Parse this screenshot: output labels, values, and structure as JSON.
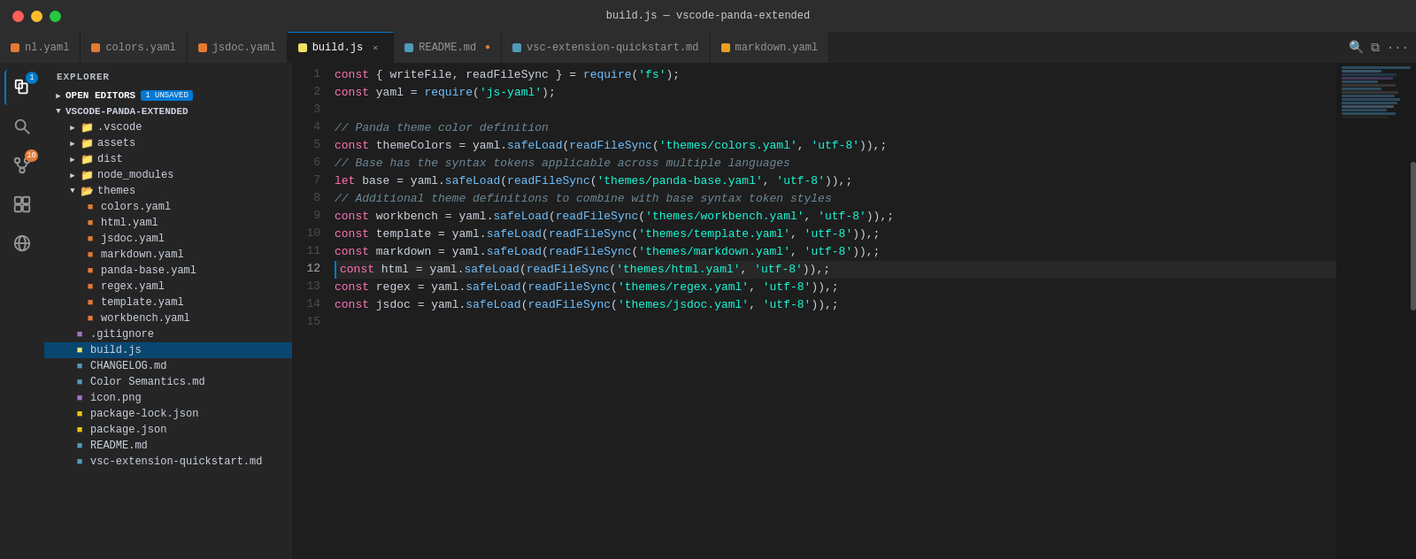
{
  "titleBar": {
    "title": "build.js — vscode-panda-extended"
  },
  "tabs": [
    {
      "id": "nl-yaml",
      "label": "nl.yaml",
      "icon": "yaml",
      "active": false,
      "modified": false,
      "color": "#e37933"
    },
    {
      "id": "colors-yaml",
      "label": "colors.yaml",
      "icon": "yaml",
      "active": false,
      "modified": false,
      "color": "#e37933"
    },
    {
      "id": "jsdoc-yaml",
      "label": "jsdoc.yaml",
      "icon": "yaml",
      "active": false,
      "modified": false,
      "color": "#e37933"
    },
    {
      "id": "build-js",
      "label": "build.js",
      "icon": "js",
      "active": true,
      "modified": false,
      "color": "#f0e164"
    },
    {
      "id": "readme-md",
      "label": "README.md",
      "icon": "md",
      "active": false,
      "modified": true,
      "color": "#519aba"
    },
    {
      "id": "vsc-quickstart",
      "label": "vsc-extension-quickstart.md",
      "icon": "md",
      "active": false,
      "modified": false,
      "color": "#519aba"
    },
    {
      "id": "markdown-yaml",
      "label": "markdown.yaml",
      "icon": "yaml",
      "active": false,
      "modified": false,
      "color": "#e8a020"
    }
  ],
  "sidebar": {
    "openEditors": {
      "label": "OPEN EDITORS",
      "badge": "1 UNSAVED"
    },
    "projectName": "VSCODE-PANDA-EXTENDED",
    "tree": [
      {
        "id": "vscode",
        "label": ".vscode",
        "type": "folder",
        "indent": 1,
        "expanded": false
      },
      {
        "id": "assets",
        "label": "assets",
        "type": "folder",
        "indent": 1,
        "expanded": false
      },
      {
        "id": "dist",
        "label": "dist",
        "type": "folder",
        "indent": 1,
        "expanded": false
      },
      {
        "id": "node_modules",
        "label": "node_modules",
        "type": "folder",
        "indent": 1,
        "expanded": false
      },
      {
        "id": "themes",
        "label": "themes",
        "type": "folder",
        "indent": 1,
        "expanded": true
      },
      {
        "id": "colors-yaml",
        "label": "colors.yaml",
        "type": "yaml",
        "indent": 2
      },
      {
        "id": "html-yaml",
        "label": "html.yaml",
        "type": "yaml",
        "indent": 2
      },
      {
        "id": "jsdoc-yaml",
        "label": "jsdoc.yaml",
        "type": "yaml",
        "indent": 2
      },
      {
        "id": "markdown-yaml",
        "label": "markdown.yaml",
        "type": "yaml",
        "indent": 2
      },
      {
        "id": "panda-base-yaml",
        "label": "panda-base.yaml",
        "type": "yaml",
        "indent": 2
      },
      {
        "id": "regex-yaml",
        "label": "regex.yaml",
        "type": "yaml",
        "indent": 2
      },
      {
        "id": "template-yaml",
        "label": "template.yaml",
        "type": "yaml",
        "indent": 2
      },
      {
        "id": "workbench-yaml",
        "label": "workbench.yaml",
        "type": "yaml",
        "indent": 2
      },
      {
        "id": "gitignore",
        "label": ".gitignore",
        "type": "gitignore",
        "indent": 1
      },
      {
        "id": "build-js",
        "label": "build.js",
        "type": "js",
        "indent": 1
      },
      {
        "id": "changelog-md",
        "label": "CHANGELOG.md",
        "type": "md",
        "indent": 1
      },
      {
        "id": "color-semantics-md",
        "label": "Color Semantics.md",
        "type": "md",
        "indent": 1
      },
      {
        "id": "icon-png",
        "label": "icon.png",
        "type": "png",
        "indent": 1
      },
      {
        "id": "package-lock-json",
        "label": "package-lock.json",
        "type": "json",
        "indent": 1
      },
      {
        "id": "package-json",
        "label": "package.json",
        "type": "json",
        "indent": 1
      },
      {
        "id": "readme-md",
        "label": "README.md",
        "type": "md",
        "indent": 1
      },
      {
        "id": "vsc-quickstart-md",
        "label": "vsc-extension-quickstart.md",
        "type": "md",
        "indent": 1
      }
    ]
  },
  "editor": {
    "filename": "build.js",
    "lines": [
      {
        "num": 1,
        "tokens": [
          {
            "t": "kw",
            "v": "const"
          },
          {
            "t": "plain",
            "v": " { writeFile, readFileSync } "
          },
          {
            "t": "op",
            "v": "="
          },
          {
            "t": "plain",
            "v": " "
          },
          {
            "t": "fn",
            "v": "require"
          },
          {
            "t": "punc",
            "v": "("
          },
          {
            "t": "str",
            "v": "'fs'"
          },
          {
            "t": "punc",
            "v": ")"
          },
          {
            "t": "plain",
            "v": ";"
          }
        ]
      },
      {
        "num": 2,
        "tokens": [
          {
            "t": "kw",
            "v": "const"
          },
          {
            "t": "plain",
            "v": " yaml "
          },
          {
            "t": "op",
            "v": "="
          },
          {
            "t": "plain",
            "v": " "
          },
          {
            "t": "fn",
            "v": "require"
          },
          {
            "t": "punc",
            "v": "("
          },
          {
            "t": "str",
            "v": "'js-yaml'"
          },
          {
            "t": "punc",
            "v": ")"
          },
          {
            "t": "plain",
            "v": ";"
          }
        ]
      },
      {
        "num": 3,
        "tokens": []
      },
      {
        "num": 4,
        "tokens": [
          {
            "t": "cm",
            "v": "// Panda theme color definition"
          }
        ]
      },
      {
        "num": 5,
        "tokens": [
          {
            "t": "kw",
            "v": "const"
          },
          {
            "t": "plain",
            "v": " themeColors "
          },
          {
            "t": "op",
            "v": "="
          },
          {
            "t": "plain",
            "v": " yaml."
          },
          {
            "t": "fn",
            "v": "safeLoad"
          },
          {
            "t": "punc",
            "v": "("
          },
          {
            "t": "fn",
            "v": "readFileSync"
          },
          {
            "t": "punc",
            "v": "("
          },
          {
            "t": "str",
            "v": "'themes/colors.yaml'"
          },
          {
            "t": "plain",
            "v": ", "
          },
          {
            "t": "str",
            "v": "'utf-8'"
          },
          {
            "t": "punc",
            "v": ")),"
          },
          {
            "t": "plain",
            "v": ";"
          }
        ]
      },
      {
        "num": 6,
        "tokens": [
          {
            "t": "cm",
            "v": "// Base has the syntax tokens applicable across multiple languages"
          }
        ]
      },
      {
        "num": 7,
        "tokens": [
          {
            "t": "kw",
            "v": "let"
          },
          {
            "t": "plain",
            "v": " base "
          },
          {
            "t": "op",
            "v": "="
          },
          {
            "t": "plain",
            "v": " yaml."
          },
          {
            "t": "fn",
            "v": "safeLoad"
          },
          {
            "t": "punc",
            "v": "("
          },
          {
            "t": "fn",
            "v": "readFileSync"
          },
          {
            "t": "punc",
            "v": "("
          },
          {
            "t": "str",
            "v": "'themes/panda-base.yaml'"
          },
          {
            "t": "plain",
            "v": ", "
          },
          {
            "t": "str",
            "v": "'utf-8'"
          },
          {
            "t": "punc",
            "v": ")),"
          },
          {
            "t": "plain",
            "v": ";"
          }
        ]
      },
      {
        "num": 8,
        "tokens": [
          {
            "t": "cm",
            "v": "// Additional theme definitions to combine with base syntax token styles"
          }
        ]
      },
      {
        "num": 9,
        "tokens": [
          {
            "t": "kw",
            "v": "const"
          },
          {
            "t": "plain",
            "v": " workbench "
          },
          {
            "t": "op",
            "v": "="
          },
          {
            "t": "plain",
            "v": " yaml."
          },
          {
            "t": "fn",
            "v": "safeLoad"
          },
          {
            "t": "punc",
            "v": "("
          },
          {
            "t": "fn",
            "v": "readFileSync"
          },
          {
            "t": "punc",
            "v": "("
          },
          {
            "t": "str",
            "v": "'themes/workbench.yaml'"
          },
          {
            "t": "plain",
            "v": ", "
          },
          {
            "t": "str",
            "v": "'utf-8'"
          },
          {
            "t": "punc",
            "v": ")),"
          },
          {
            "t": "plain",
            "v": ";"
          }
        ]
      },
      {
        "num": 10,
        "tokens": [
          {
            "t": "kw",
            "v": "const"
          },
          {
            "t": "plain",
            "v": " template "
          },
          {
            "t": "op",
            "v": "="
          },
          {
            "t": "plain",
            "v": " yaml."
          },
          {
            "t": "fn",
            "v": "safeLoad"
          },
          {
            "t": "punc",
            "v": "("
          },
          {
            "t": "fn",
            "v": "readFileSync"
          },
          {
            "t": "punc",
            "v": "("
          },
          {
            "t": "str",
            "v": "'themes/template.yaml'"
          },
          {
            "t": "plain",
            "v": ", "
          },
          {
            "t": "str",
            "v": "'utf-8'"
          },
          {
            "t": "punc",
            "v": ")),"
          },
          {
            "t": "plain",
            "v": ";"
          }
        ]
      },
      {
        "num": 11,
        "tokens": [
          {
            "t": "kw",
            "v": "const"
          },
          {
            "t": "plain",
            "v": " markdown "
          },
          {
            "t": "op",
            "v": "="
          },
          {
            "t": "plain",
            "v": " yaml."
          },
          {
            "t": "fn",
            "v": "safeLoad"
          },
          {
            "t": "punc",
            "v": "("
          },
          {
            "t": "fn",
            "v": "readFileSync"
          },
          {
            "t": "punc",
            "v": "("
          },
          {
            "t": "str",
            "v": "'themes/markdown.yaml'"
          },
          {
            "t": "plain",
            "v": ", "
          },
          {
            "t": "str",
            "v": "'utf-8'"
          },
          {
            "t": "punc",
            "v": ")),"
          },
          {
            "t": "plain",
            "v": ";"
          }
        ]
      },
      {
        "num": 12,
        "active": true,
        "tokens": [
          {
            "t": "kw",
            "v": "const"
          },
          {
            "t": "plain",
            "v": " html "
          },
          {
            "t": "op",
            "v": "="
          },
          {
            "t": "plain",
            "v": " yaml."
          },
          {
            "t": "fn",
            "v": "safeLoad"
          },
          {
            "t": "punc",
            "v": "("
          },
          {
            "t": "fn",
            "v": "readFileSync"
          },
          {
            "t": "punc",
            "v": "("
          },
          {
            "t": "str",
            "v": "'themes/html.yaml'"
          },
          {
            "t": "plain",
            "v": ", "
          },
          {
            "t": "str",
            "v": "'utf-8'"
          },
          {
            "t": "punc",
            "v": ")),"
          },
          {
            "t": "plain",
            "v": ";"
          }
        ]
      },
      {
        "num": 13,
        "tokens": [
          {
            "t": "kw",
            "v": "const"
          },
          {
            "t": "plain",
            "v": " regex "
          },
          {
            "t": "op",
            "v": "="
          },
          {
            "t": "plain",
            "v": " yaml."
          },
          {
            "t": "fn",
            "v": "safeLoad"
          },
          {
            "t": "punc",
            "v": "("
          },
          {
            "t": "fn",
            "v": "readFileSync"
          },
          {
            "t": "punc",
            "v": "("
          },
          {
            "t": "str",
            "v": "'themes/regex.yaml'"
          },
          {
            "t": "plain",
            "v": ", "
          },
          {
            "t": "str",
            "v": "'utf-8'"
          },
          {
            "t": "punc",
            "v": ")),"
          },
          {
            "t": "plain",
            "v": ";"
          }
        ]
      },
      {
        "num": 14,
        "tokens": [
          {
            "t": "kw",
            "v": "const"
          },
          {
            "t": "plain",
            "v": " jsdoc "
          },
          {
            "t": "op",
            "v": "="
          },
          {
            "t": "plain",
            "v": " yaml."
          },
          {
            "t": "fn",
            "v": "safeLoad"
          },
          {
            "t": "punc",
            "v": "("
          },
          {
            "t": "fn",
            "v": "readFileSync"
          },
          {
            "t": "punc",
            "v": "("
          },
          {
            "t": "str",
            "v": "'themes/jsdoc.yaml'"
          },
          {
            "t": "plain",
            "v": ", "
          },
          {
            "t": "str",
            "v": "'utf-8'"
          },
          {
            "t": "punc",
            "v": ")),"
          },
          {
            "t": "plain",
            "v": ";"
          }
        ]
      },
      {
        "num": 15,
        "tokens": []
      }
    ]
  }
}
